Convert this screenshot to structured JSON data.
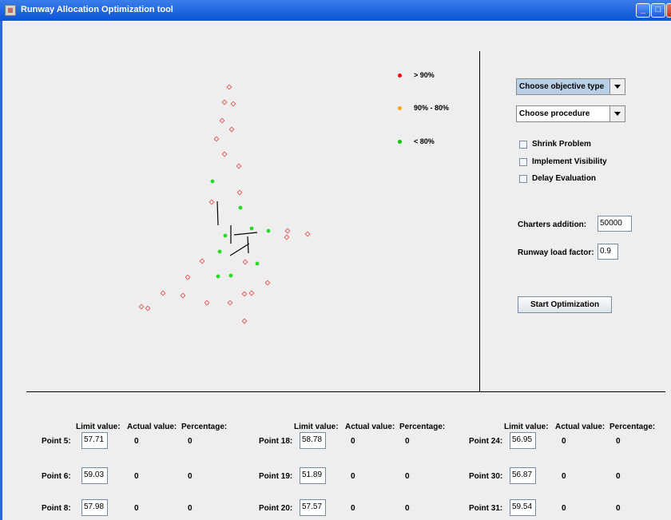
{
  "window": {
    "title": "Runway Allocation Optimization tool",
    "buttons": [
      "_",
      "□",
      "X"
    ]
  },
  "legend": [
    {
      "label": "> 90%",
      "color": "#ff0000"
    },
    {
      "label": "90% - 80%",
      "color": "#ffaa00"
    },
    {
      "label": "< 80%",
      "color": "#00cc00"
    }
  ],
  "controls": {
    "objective_combo": "Choose objective type",
    "procedure_combo": "Choose procedure",
    "shrink_problem": "Shrink Problem",
    "implement_visibility": "Implement Visibility",
    "delay_evaluation": "Delay Evaluation",
    "charters_label": "Charters addition:",
    "charters_value": "50000",
    "load_factor_label": "Runway load factor:",
    "load_factor_value": "0.9",
    "start_button": "Start Optimization"
  },
  "headers": {
    "limit": "Limit value:",
    "actual": "Actual value:",
    "percentage": "Percentage:"
  },
  "columns": [
    {
      "rows": [
        {
          "point": "Point 5:",
          "limit": "57.71",
          "actual": "0",
          "percentage": "0"
        },
        {
          "point": "Point 6:",
          "limit": "59.03",
          "actual": "0",
          "percentage": "0"
        },
        {
          "point": "Point 8:",
          "limit": "57.98",
          "actual": "0",
          "percentage": "0"
        }
      ]
    },
    {
      "rows": [
        {
          "point": "Point 18:",
          "limit": "58.78",
          "actual": "0",
          "percentage": "0"
        },
        {
          "point": "Point 19:",
          "limit": "51.89",
          "actual": "0",
          "percentage": "0"
        },
        {
          "point": "Point 20:",
          "limit": "57.57",
          "actual": "0",
          "percentage": "0"
        }
      ]
    },
    {
      "rows": [
        {
          "point": "Point 24:",
          "limit": "56.95",
          "actual": "0",
          "percentage": "0"
        },
        {
          "point": "Point 30:",
          "limit": "56.87",
          "actual": "0",
          "percentage": "0"
        },
        {
          "point": "Point 31:",
          "limit": "59.54",
          "actual": "0",
          "percentage": "0"
        }
      ]
    }
  ],
  "plot": {
    "colors": {
      "open": "#e05050",
      "green": "#22dd22",
      "runway": "#000000"
    }
  }
}
